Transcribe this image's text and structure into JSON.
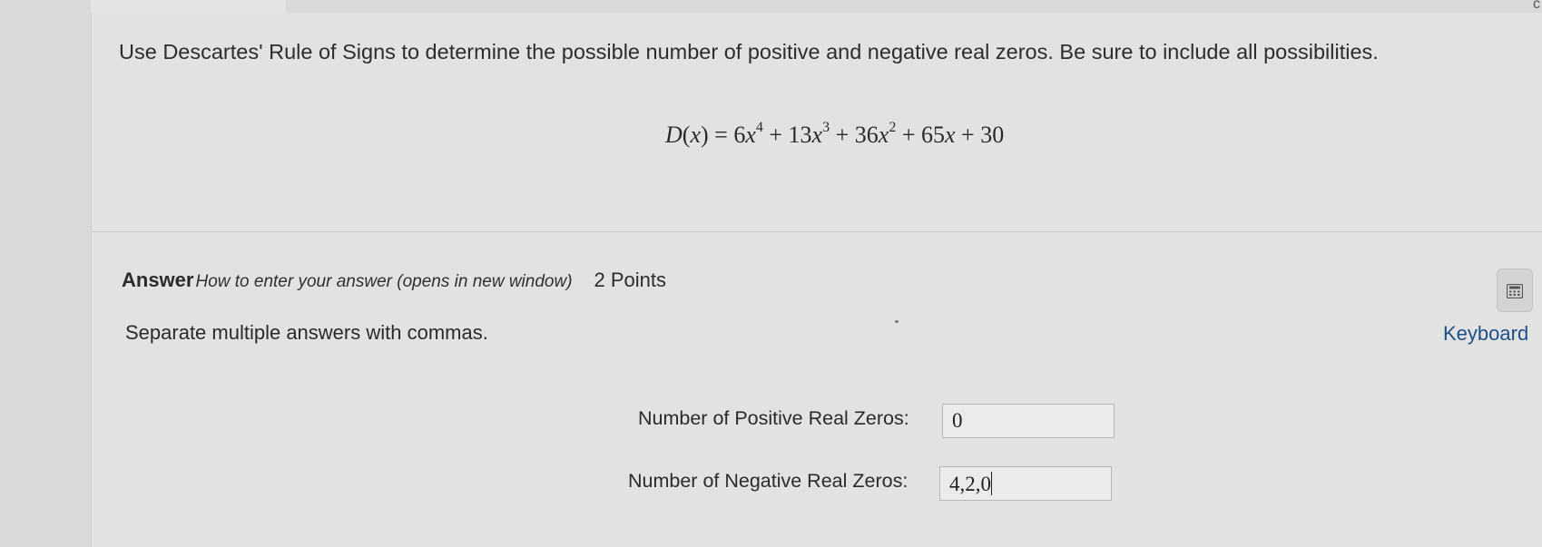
{
  "question": {
    "text": "Use Descartes' Rule of Signs to determine the possible number of positive and negative real zeros. Be sure to include all possibilities.",
    "equation": {
      "lhs": "D(x) = ",
      "terms": [
        {
          "coef": "6",
          "var": "x",
          "exp": "4",
          "op": "+"
        },
        {
          "coef": "13",
          "var": "x",
          "exp": "3",
          "op": "+"
        },
        {
          "coef": "36",
          "var": "x",
          "exp": "2",
          "op": "+"
        },
        {
          "coef": "65",
          "var": "x",
          "exp": "",
          "op": "+"
        },
        {
          "coef": "30",
          "var": "",
          "exp": "",
          "op": ""
        }
      ]
    }
  },
  "answer": {
    "title": "Answer",
    "help_link": "How to enter your answer (opens in new window)",
    "points": "2 Points",
    "instructions": "Separate multiple answers with commas.",
    "keyboard_label": "Keyboard",
    "keyboard_icon": "calculator-icon",
    "positive": {
      "label": "Number of Positive Real Zeros:",
      "value": "0"
    },
    "negative": {
      "label": "Number of Negative Real Zeros:",
      "value": "4,2,0"
    }
  }
}
